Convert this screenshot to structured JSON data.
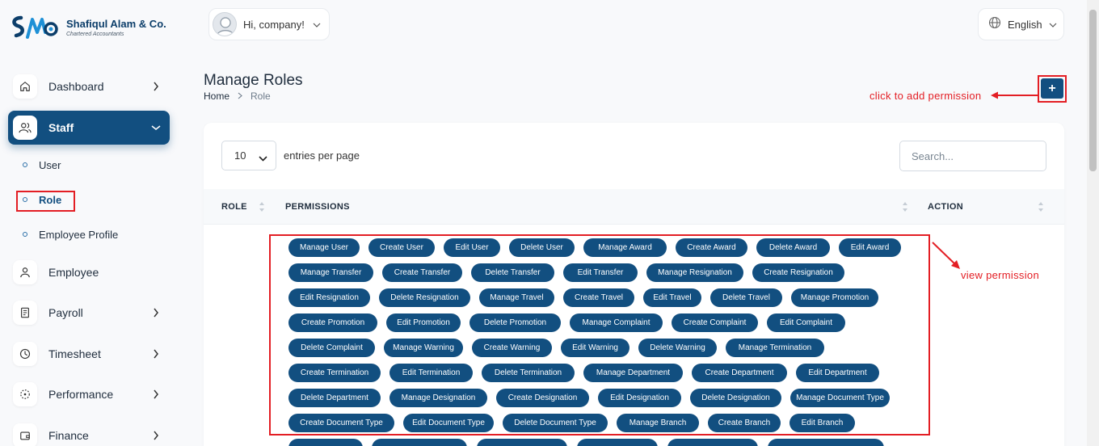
{
  "brand": {
    "title": "Shafiqul Alam & Co.",
    "subtitle": "Chartered Accountants"
  },
  "header": {
    "greeting": "Hi, company!",
    "language": "English"
  },
  "sidebar": {
    "items": [
      {
        "label": "Dashboard",
        "icon": "home-icon",
        "chevron": "right"
      },
      {
        "label": "Staff",
        "icon": "users-icon",
        "chevron": "down",
        "active": true
      },
      {
        "label": "Employee",
        "icon": "user-icon"
      },
      {
        "label": "Payroll",
        "icon": "receipt-icon",
        "chevron": "right"
      },
      {
        "label": "Timesheet",
        "icon": "clock-icon",
        "chevron": "right"
      },
      {
        "label": "Performance",
        "icon": "gauge-icon",
        "chevron": "right"
      },
      {
        "label": "Finance",
        "icon": "wallet-icon",
        "chevron": "right"
      }
    ],
    "staff_sub": [
      {
        "label": "User"
      },
      {
        "label": "Role",
        "active": true
      },
      {
        "label": "Employee Profile"
      }
    ]
  },
  "page": {
    "title": "Manage Roles",
    "breadcrumb": {
      "home": "Home",
      "current": "Role"
    },
    "add_button": "+"
  },
  "annotations": {
    "add": "click to add permission",
    "view": "view permission"
  },
  "table": {
    "entries_value": "10",
    "entries_label": "entries per page",
    "search_placeholder": "Search...",
    "columns": {
      "role": "ROLE",
      "permissions": "PERMISSIONS",
      "action": "ACTION"
    },
    "permission_rows": [
      [
        "Manage User",
        "Create User",
        "Edit User",
        "Delete User",
        "Manage Award",
        "Create Award",
        "Delete Award",
        "Edit Award"
      ],
      [
        "Manage Transfer",
        "Create Transfer",
        "Delete Transfer",
        "Edit Transfer",
        "Manage Resignation",
        "Create Resignation"
      ],
      [
        "Edit Resignation",
        "Delete Resignation",
        "Manage Travel",
        "Create Travel",
        "Edit Travel",
        "Delete Travel",
        "Manage Promotion"
      ],
      [
        "Create Promotion",
        "Edit Promotion",
        "Delete Promotion",
        "Manage Complaint",
        "Create Complaint",
        "Edit Complaint"
      ],
      [
        "Delete Complaint",
        "Manage Warning",
        "Create Warning",
        "Edit Warning",
        "Delete Warning",
        "Manage Termination"
      ],
      [
        "Create Termination",
        "Edit Termination",
        "Delete Termination",
        "Manage Department",
        "Create Department",
        "Edit Department"
      ],
      [
        "Delete Department",
        "Manage Designation",
        "Create Designation",
        "Edit Designation",
        "Delete Designation",
        "Manage Document Type"
      ],
      [
        "Create Document Type",
        "Edit Document Type",
        "Delete Document Type",
        "Manage Branch",
        "Create Branch",
        "Edit Branch"
      ]
    ]
  },
  "colors": {
    "primary": "#124f80",
    "annotation": "#e31e24"
  }
}
